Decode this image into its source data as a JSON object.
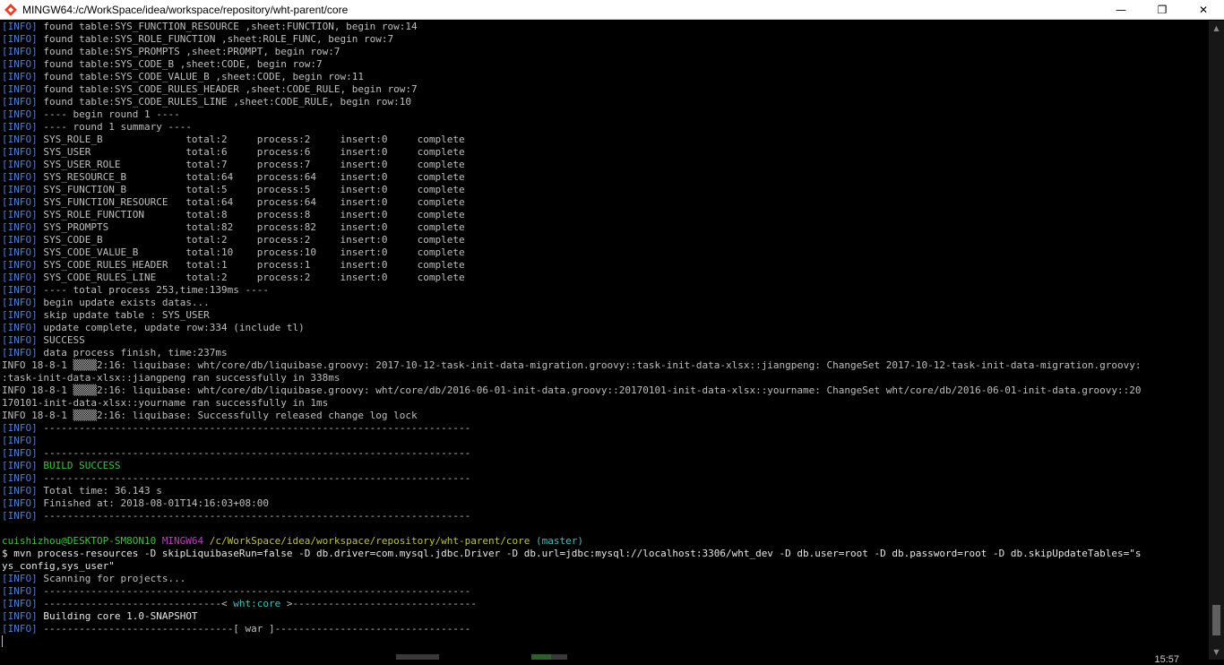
{
  "window": {
    "title": "MINGW64:/c/WorkSpace/idea/workspace/repository/wht-parent/core",
    "minimize_glyph": "—",
    "maximize_glyph": "❐",
    "close_glyph": "✕"
  },
  "colors": {
    "info_tag": "#4f7fd6",
    "success": "#3ec43e",
    "prompt_user": "#3ec43e",
    "prompt_env": "#c13ec1",
    "prompt_path": "#c1c13e",
    "prompt_branch": "#3ec1c1"
  },
  "terminal": {
    "info_tag": "[INFO]",
    "lines": [
      " found table:SYS_FUNCTION_RESOURCE ,sheet:FUNCTION, begin row:14",
      " found table:SYS_ROLE_FUNCTION ,sheet:ROLE_FUNC, begin row:7",
      " found table:SYS_PROMPTS ,sheet:PROMPT, begin row:7",
      " found table:SYS_CODE_B ,sheet:CODE, begin row:7",
      " found table:SYS_CODE_VALUE_B ,sheet:CODE, begin row:11",
      " found table:SYS_CODE_RULES_HEADER ,sheet:CODE_RULE, begin row:7",
      " found table:SYS_CODE_RULES_LINE ,sheet:CODE_RULE, begin row:10",
      " ---- begin round 1 ----",
      " ---- round 1 summary ----",
      " SYS_ROLE_B              total:2     process:2     insert:0     complete",
      " SYS_USER                total:6     process:6     insert:0     complete",
      " SYS_USER_ROLE           total:7     process:7     insert:0     complete",
      " SYS_RESOURCE_B          total:64    process:64    insert:0     complete",
      " SYS_FUNCTION_B          total:5     process:5     insert:0     complete",
      " SYS_FUNCTION_RESOURCE   total:64    process:64    insert:0     complete",
      " SYS_ROLE_FUNCTION       total:8     process:8     insert:0     complete",
      " SYS_PROMPTS             total:82    process:82    insert:0     complete",
      " SYS_CODE_B              total:2     process:2     insert:0     complete",
      " SYS_CODE_VALUE_B        total:10    process:10    insert:0     complete",
      " SYS_CODE_RULES_HEADER   total:1     process:1     insert:0     complete",
      " SYS_CODE_RULES_LINE     total:2     process:2     insert:0     complete",
      " ---- total process 253,time:139ms ----",
      " begin update exists datas...",
      " skip update table : SYS_USER",
      " update complete, update row:334 (include tl)",
      " SUCCESS",
      " data process finish, time:237ms"
    ],
    "liquibase_lines": [
      "INFO 18-8-1 ▒▒▒▒2:16: liquibase: wht/core/db/liquibase.groovy: 2017-10-12-task-init-data-migration.groovy::task-init-data-xlsx::jiangpeng: ChangeSet 2017-10-12-task-init-data-migration.groovy:",
      ":task-init-data-xlsx::jiangpeng ran successfully in 338ms",
      "INFO 18-8-1 ▒▒▒▒2:16: liquibase: wht/core/db/liquibase.groovy: wht/core/db/2016-06-01-init-data.groovy::20170101-init-data-xlsx::yourname: ChangeSet wht/core/db/2016-06-01-init-data.groovy::20",
      "170101-init-data-xlsx::yourname ran successfully in 1ms",
      "INFO 18-8-1 ▒▒▒▒2:16: liquibase: Successfully released change log lock"
    ],
    "separator": " ------------------------------------------------------------------------",
    "blank": "",
    "build_success": " BUILD SUCCESS",
    "total_time": " Total time: 36.143 s",
    "finished_at": " Finished at: 2018-08-01T14:16:03+08:00",
    "prompt": {
      "user_host": "cuishizhou@DESKTOP-SM8ON10",
      "env": "MINGW64",
      "path": "/c/WorkSpace/idea/workspace/repository/wht-parent/core",
      "branch": "(master)"
    },
    "command_line_1": "$ mvn process-resources -D skipLiquibaseRun=false -D db.driver=com.mysql.jdbc.Driver -D db.url=jdbc:mysql://localhost:3306/wht_dev -D db.user=root -D db.password=root -D db.skipUpdateTables=\"s",
    "command_line_2": "ys_config,sys_user\"",
    "scanning": " Scanning for projects...",
    "module_sep_left": " ------------------------------< ",
    "module_name": "wht:core",
    "module_sep_right": " >-------------------------------",
    "building": " Building core 1.0-SNAPSHOT",
    "war_sep": " --------------------------------[ war ]---------------------------------"
  },
  "clock_fragment": "15:57"
}
